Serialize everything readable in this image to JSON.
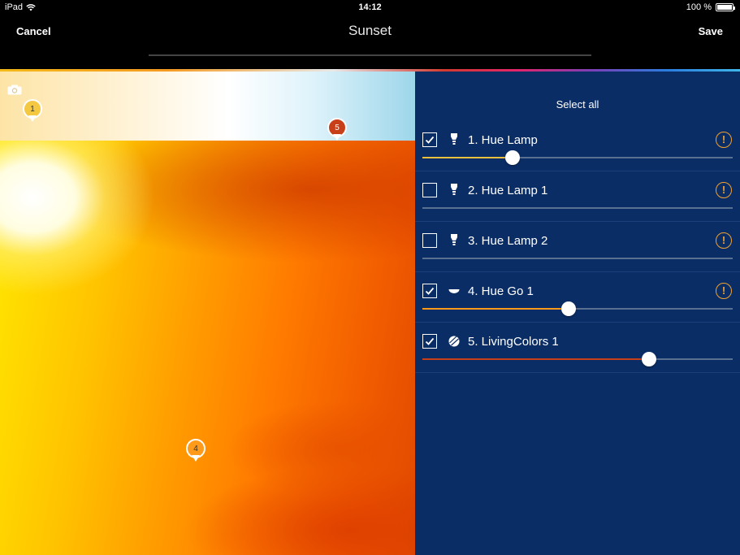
{
  "status_bar": {
    "device": "iPad",
    "time": "14:12",
    "battery": "100 %"
  },
  "nav": {
    "cancel_label": "Cancel",
    "title": "Sunset",
    "save_label": "Save"
  },
  "scene": {
    "pins": [
      {
        "label": "1",
        "color": "#f5c842"
      },
      {
        "label": "5",
        "color": "#c8401a"
      },
      {
        "label": "4",
        "color": "#ff9a1a"
      }
    ]
  },
  "panel": {
    "select_all_label": "Select all",
    "lights": [
      {
        "name": "1. Hue Lamp",
        "checked": true,
        "icon": "hue-lamp-icon",
        "warning": true,
        "slider": 0.29,
        "fill_color": "#e8c040"
      },
      {
        "name": "2. Hue Lamp 1",
        "checked": false,
        "icon": "hue-lamp-icon",
        "warning": true,
        "slider": null,
        "fill_color": "#5a7090"
      },
      {
        "name": "3. Hue Lamp 2",
        "checked": false,
        "icon": "hue-lamp-icon",
        "warning": true,
        "slider": null,
        "fill_color": "#5a7090"
      },
      {
        "name": "4. Hue Go 1",
        "checked": true,
        "icon": "hue-go-icon",
        "warning": true,
        "slider": 0.47,
        "fill_color": "#ff9a1a"
      },
      {
        "name": "5. LivingColors 1",
        "checked": true,
        "icon": "livingcolors-icon",
        "warning": false,
        "slider": 0.73,
        "fill_color": "#c8401a"
      }
    ]
  }
}
